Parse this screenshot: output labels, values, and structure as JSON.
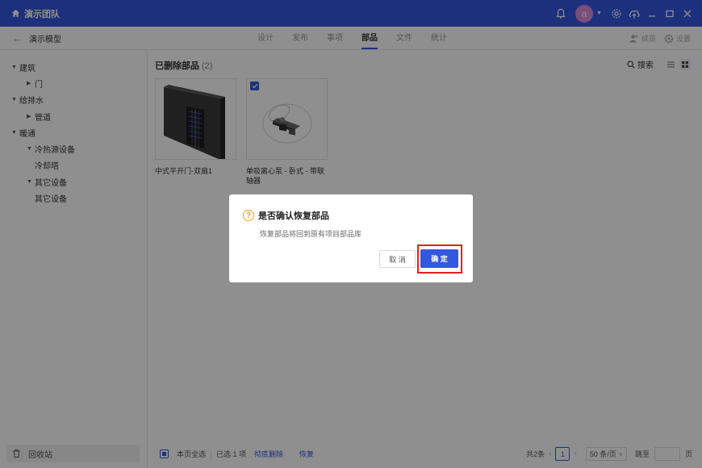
{
  "titlebar": {
    "team_name": "演示团队",
    "avatar_letter": "a",
    "brand_color": "#3457e0"
  },
  "navbar": {
    "project_name": "演示模型",
    "tabs": [
      {
        "label": "设计"
      },
      {
        "label": "发布"
      },
      {
        "label": "事项"
      },
      {
        "label": "部品",
        "active": true
      },
      {
        "label": "文件"
      },
      {
        "label": "统计"
      }
    ],
    "members_label": "成员",
    "settings_label": "设置"
  },
  "sidebar": {
    "tree": [
      {
        "label": "建筑",
        "expanded": true
      },
      {
        "label": "门",
        "expanded": false
      },
      {
        "label": "给排水",
        "expanded": true
      },
      {
        "label": "管道",
        "expanded": false
      },
      {
        "label": "暖通",
        "expanded": true
      },
      {
        "label": "冷热源设备",
        "expanded": true
      },
      {
        "label": "冷却塔"
      },
      {
        "label": "其它设备",
        "expanded": true
      },
      {
        "label": "其它设备"
      }
    ],
    "recycle_label": "回收站"
  },
  "main": {
    "title": "已删除部品",
    "count": "(2)",
    "search_label": "搜索",
    "items": [
      {
        "label": "中式平开门-双扇1",
        "checked": false
      },
      {
        "label": "单吸离心泵 - 卧式 - 带联轴器",
        "checked": true
      }
    ]
  },
  "bottombar": {
    "select_all_label": "本页全选",
    "selected_label": "已选 1 项",
    "delete_label": "彻底删除",
    "restore_label": "恢复",
    "total_label": "共2条",
    "current_page": "1",
    "page_size_label": "50 条/页",
    "jump_label": "跳至",
    "page_unit": "页"
  },
  "dialog": {
    "title": "是否确认恢复部品",
    "message": "恢复部品将回到原有项目部品库",
    "cancel_label": "取 消",
    "ok_label": "确 定"
  }
}
